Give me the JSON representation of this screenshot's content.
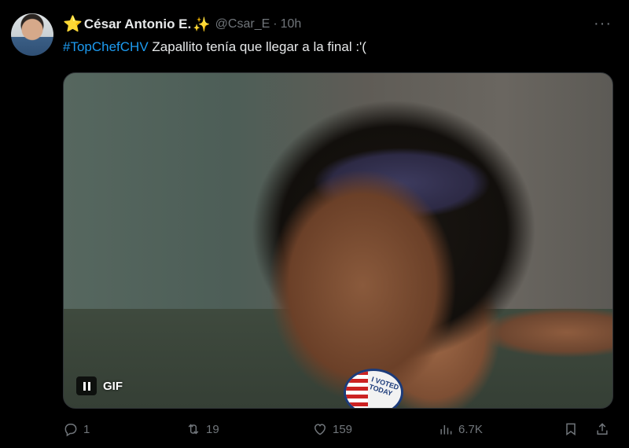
{
  "tweet": {
    "author": {
      "star": "⭐",
      "name": "César Antonio E.",
      "sparkle": "✨",
      "handle": "@Csar_E",
      "separator": "·",
      "time": "10h"
    },
    "more_label": "···",
    "hashtag": "#TopChefCHV",
    "text": " Zapallito tenía que llegar a la final :'(",
    "media": {
      "type": "gif",
      "gif_label": "GIF",
      "badge_text": "I VOTED TODAY"
    },
    "actions": {
      "replies": "1",
      "retweets": "19",
      "likes": "159",
      "views": "6.7K"
    }
  }
}
